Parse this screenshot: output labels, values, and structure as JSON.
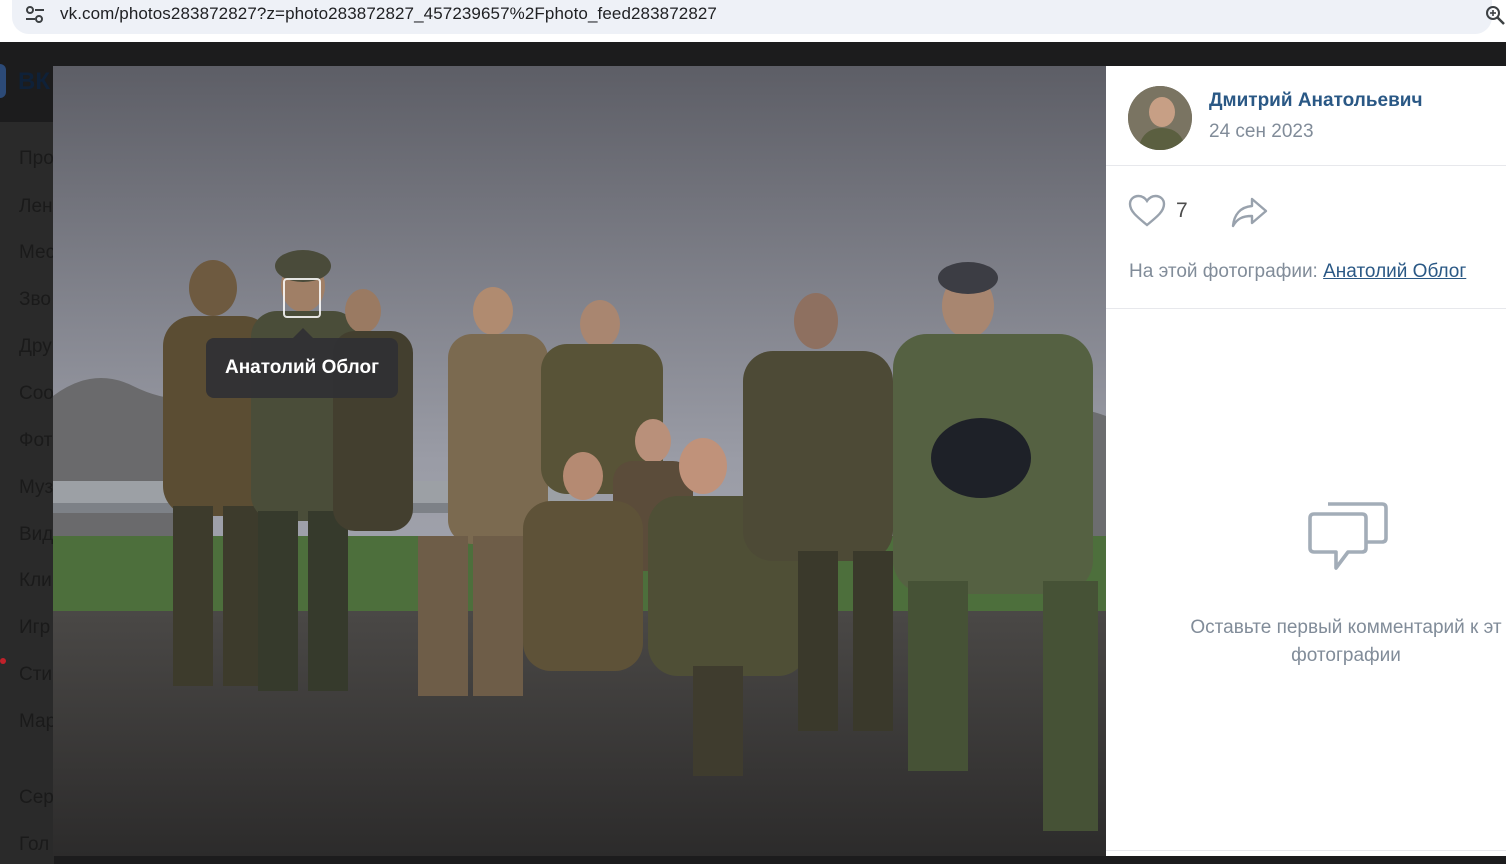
{
  "browser": {
    "url": "vk.com/photos283872827?z=photo283872827_457239657%2Fphoto_feed283872827"
  },
  "vk": {
    "logo_text": "ВК",
    "sidebar": [
      "Про",
      "Лен",
      "Мес",
      "Зво",
      "Дру",
      "Соо",
      "Фот",
      "Муз",
      "Вид",
      "Кли",
      "Игр",
      "Сти",
      "Мар",
      "Сер",
      "Гол"
    ]
  },
  "photo": {
    "tag_name": "Анатолий Облог"
  },
  "panel": {
    "author_name": "Дмитрий Анатольевич",
    "date": "24 сен 2023",
    "likes": "7",
    "in_photo_label": "На этой фотографии:",
    "in_photo_person": "Анатолий Облог",
    "empty_comments": "Оставьте первый комментарий к эт фотографии"
  },
  "icons": {
    "site_info": "tune-icon",
    "zoom": "zoom-icon",
    "like": "heart-icon",
    "share": "share-arrow-icon",
    "comments": "comments-bubble-icon"
  },
  "colors": {
    "link": "#2a5885",
    "muted": "#818c99"
  }
}
